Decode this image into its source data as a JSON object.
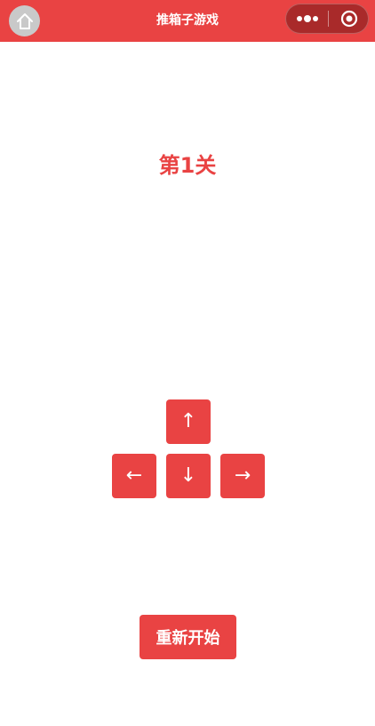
{
  "navbar": {
    "title": "推箱子游戏",
    "home_icon": "home-icon",
    "more_icon": "more-dots-icon",
    "close_icon": "target-circle-icon",
    "color": "#e94343"
  },
  "game": {
    "level_title": "第1关"
  },
  "controls": {
    "up": "↑",
    "left": "←",
    "down": "↓",
    "right": "→"
  },
  "actions": {
    "restart_label": "重新开始"
  },
  "colors": {
    "accent": "#e94343",
    "capsule": "#a92a2a",
    "home_bg": "#c9c9c9",
    "background": "#ffffff"
  }
}
